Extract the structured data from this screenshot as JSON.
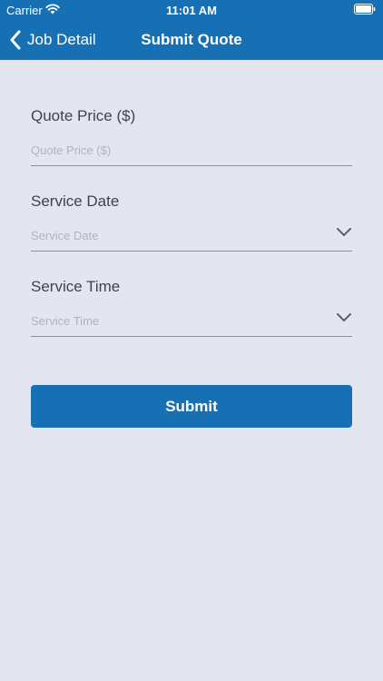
{
  "status_bar": {
    "carrier": "Carrier",
    "time": "11:01 AM",
    "wifi_icon": "wifi-icon",
    "battery_icon": "battery-icon"
  },
  "nav": {
    "back_label": "Job Detail",
    "back_icon": "chevron-left-icon",
    "title": "Submit Quote",
    "color": "#1670b3"
  },
  "form": {
    "quote_price": {
      "label": "Quote Price ($)",
      "placeholder": "Quote Price ($)",
      "value": ""
    },
    "service_date": {
      "label": "Service Date",
      "placeholder": "Service Date",
      "value": "",
      "icon": "chevron-down-icon"
    },
    "service_time": {
      "label": "Service Time",
      "placeholder": "Service Time",
      "value": "",
      "icon": "chevron-down-icon"
    }
  },
  "submit": {
    "label": "Submit",
    "color": "#1670b3"
  },
  "background_color": "#e3e6ef"
}
